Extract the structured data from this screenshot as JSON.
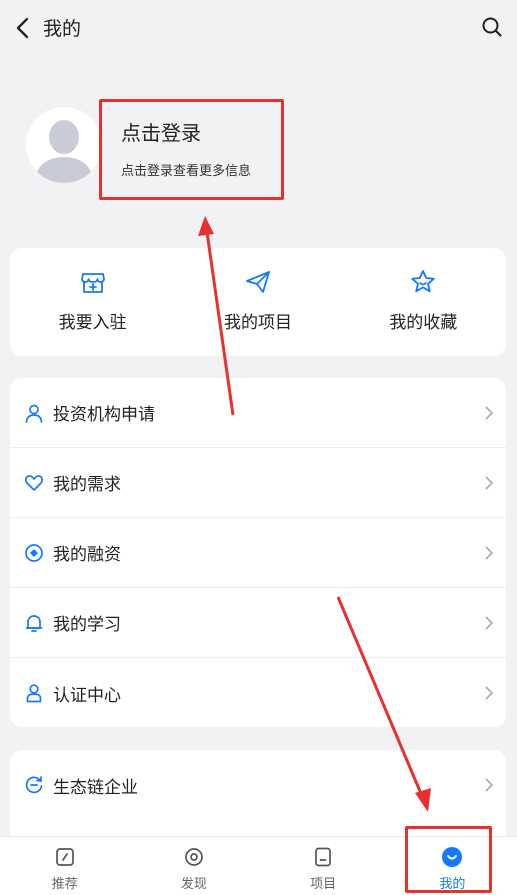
{
  "header": {
    "title": "我的",
    "back_icon": "chevron-left-icon",
    "search_icon": "search-icon"
  },
  "profile": {
    "login_title": "点击登录",
    "login_subtitle": "点击登录查看更多信息",
    "avatar_icon": "avatar-placeholder-icon"
  },
  "quick_actions": [
    {
      "label": "我要入驻",
      "icon": "store-icon"
    },
    {
      "label": "我的项目",
      "icon": "send-icon"
    },
    {
      "label": "我的收藏",
      "icon": "star-icon"
    }
  ],
  "menu": [
    {
      "label": "投资机构申请",
      "icon": "user-icon"
    },
    {
      "label": "我的需求",
      "icon": "heart-icon"
    },
    {
      "label": "我的融资",
      "icon": "diamond-icon"
    },
    {
      "label": "我的学习",
      "icon": "bell-icon"
    },
    {
      "label": "认证中心",
      "icon": "person-icon"
    }
  ],
  "menu2": [
    {
      "label": "生态链企业",
      "icon": "refresh-icon"
    }
  ],
  "tabs": [
    {
      "label": "推荐",
      "icon": "recommend-icon",
      "active": false
    },
    {
      "label": "发现",
      "icon": "discover-icon",
      "active": false
    },
    {
      "label": "项目",
      "icon": "project-icon",
      "active": false
    },
    {
      "label": "我的",
      "icon": "mine-icon",
      "active": true
    }
  ],
  "colors": {
    "accent": "#1677ff",
    "annotation": "#e8302f",
    "background": "#f2f2f4"
  }
}
